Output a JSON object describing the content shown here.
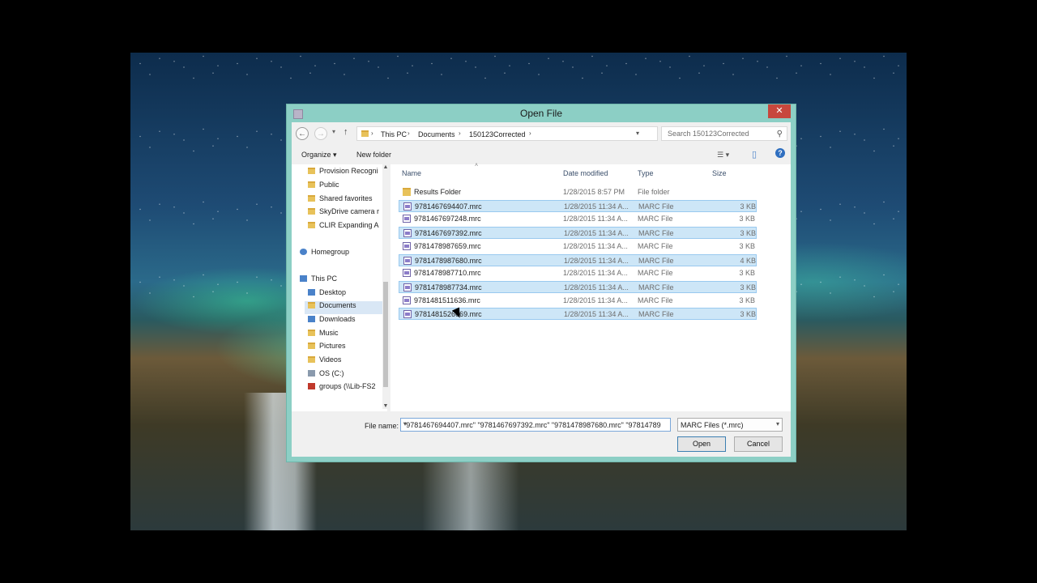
{
  "dialog": {
    "title": "Open File",
    "close_glyph": "✕"
  },
  "navigation": {
    "back_glyph": "←",
    "forward_glyph": "→",
    "recent_glyph": "▾",
    "up_glyph": "↑",
    "refresh_glyph": "↻",
    "breadcrumb": [
      "This PC",
      "Documents",
      "150123Corrected"
    ],
    "search_placeholder": "Search 150123Corrected"
  },
  "toolbar": {
    "organize": "Organize ▾",
    "new_folder": "New folder",
    "view_glyph": "☰ ▾",
    "pane_glyph": "▯",
    "help_glyph": "?"
  },
  "sidebar": {
    "items": [
      {
        "label": "Provision Recogni",
        "icon": "folder-icon"
      },
      {
        "label": "Public",
        "icon": "folder-icon"
      },
      {
        "label": "Shared favorites",
        "icon": "folder-icon"
      },
      {
        "label": "SkyDrive camera r",
        "icon": "folder-icon"
      },
      {
        "label": "CLIR Expanding A",
        "icon": "folder-icon"
      },
      {
        "label": "Homegroup",
        "icon": "homegroup-icon"
      },
      {
        "label": "This PC",
        "icon": "computer-icon"
      },
      {
        "label": "Desktop",
        "icon": "desktop-icon"
      },
      {
        "label": "Documents",
        "icon": "documents-icon"
      },
      {
        "label": "Downloads",
        "icon": "downloads-icon"
      },
      {
        "label": "Music",
        "icon": "music-icon"
      },
      {
        "label": "Pictures",
        "icon": "pictures-icon"
      },
      {
        "label": "Videos",
        "icon": "videos-icon"
      },
      {
        "label": "OS (C:)",
        "icon": "drive-icon"
      },
      {
        "label": "groups (\\\\Lib-FS2",
        "icon": "network-drive-icon"
      }
    ],
    "selected": "Documents"
  },
  "file_list": {
    "columns": [
      "Name",
      "Date modified",
      "Type",
      "Size"
    ],
    "rows": [
      {
        "name": "Results Folder",
        "date": "1/28/2015 8:57 PM",
        "type": "File folder",
        "size": "",
        "selected": false,
        "kind": "folder"
      },
      {
        "name": "9781467694407.mrc",
        "date": "1/28/2015 11:34 A...",
        "type": "MARC File",
        "size": "3 KB",
        "selected": true,
        "kind": "marc"
      },
      {
        "name": "9781467697248.mrc",
        "date": "1/28/2015 11:34 A...",
        "type": "MARC File",
        "size": "3 KB",
        "selected": false,
        "kind": "marc"
      },
      {
        "name": "9781467697392.mrc",
        "date": "1/28/2015 11:34 A...",
        "type": "MARC File",
        "size": "3 KB",
        "selected": true,
        "kind": "marc"
      },
      {
        "name": "9781478987659.mrc",
        "date": "1/28/2015 11:34 A...",
        "type": "MARC File",
        "size": "3 KB",
        "selected": false,
        "kind": "marc"
      },
      {
        "name": "9781478987680.mrc",
        "date": "1/28/2015 11:34 A...",
        "type": "MARC File",
        "size": "4 KB",
        "selected": true,
        "kind": "marc"
      },
      {
        "name": "9781478987710.mrc",
        "date": "1/28/2015 11:34 A...",
        "type": "MARC File",
        "size": "3 KB",
        "selected": false,
        "kind": "marc"
      },
      {
        "name": "9781478987734.mrc",
        "date": "1/28/2015 11:34 A...",
        "type": "MARC File",
        "size": "3 KB",
        "selected": true,
        "kind": "marc"
      },
      {
        "name": "9781481511636.mrc",
        "date": "1/28/2015 11:34 A...",
        "type": "MARC File",
        "size": "3 KB",
        "selected": false,
        "kind": "marc"
      },
      {
        "name": "9781481526669.mrc",
        "date": "1/28/2015 11:34 A...",
        "type": "MARC File",
        "size": "3 KB",
        "selected": true,
        "kind": "marc"
      }
    ]
  },
  "footer": {
    "file_name_label": "File name:",
    "file_name_value": "\"9781467694407.mrc\" \"9781467697392.mrc\" \"9781478987680.mrc\" \"97814789",
    "file_type": "MARC Files (*.mrc)",
    "open_label": "Open",
    "cancel_label": "Cancel"
  },
  "colors": {
    "frame": "#8ccfc5",
    "close": "#c7473d",
    "selection": "#cde6f7"
  }
}
